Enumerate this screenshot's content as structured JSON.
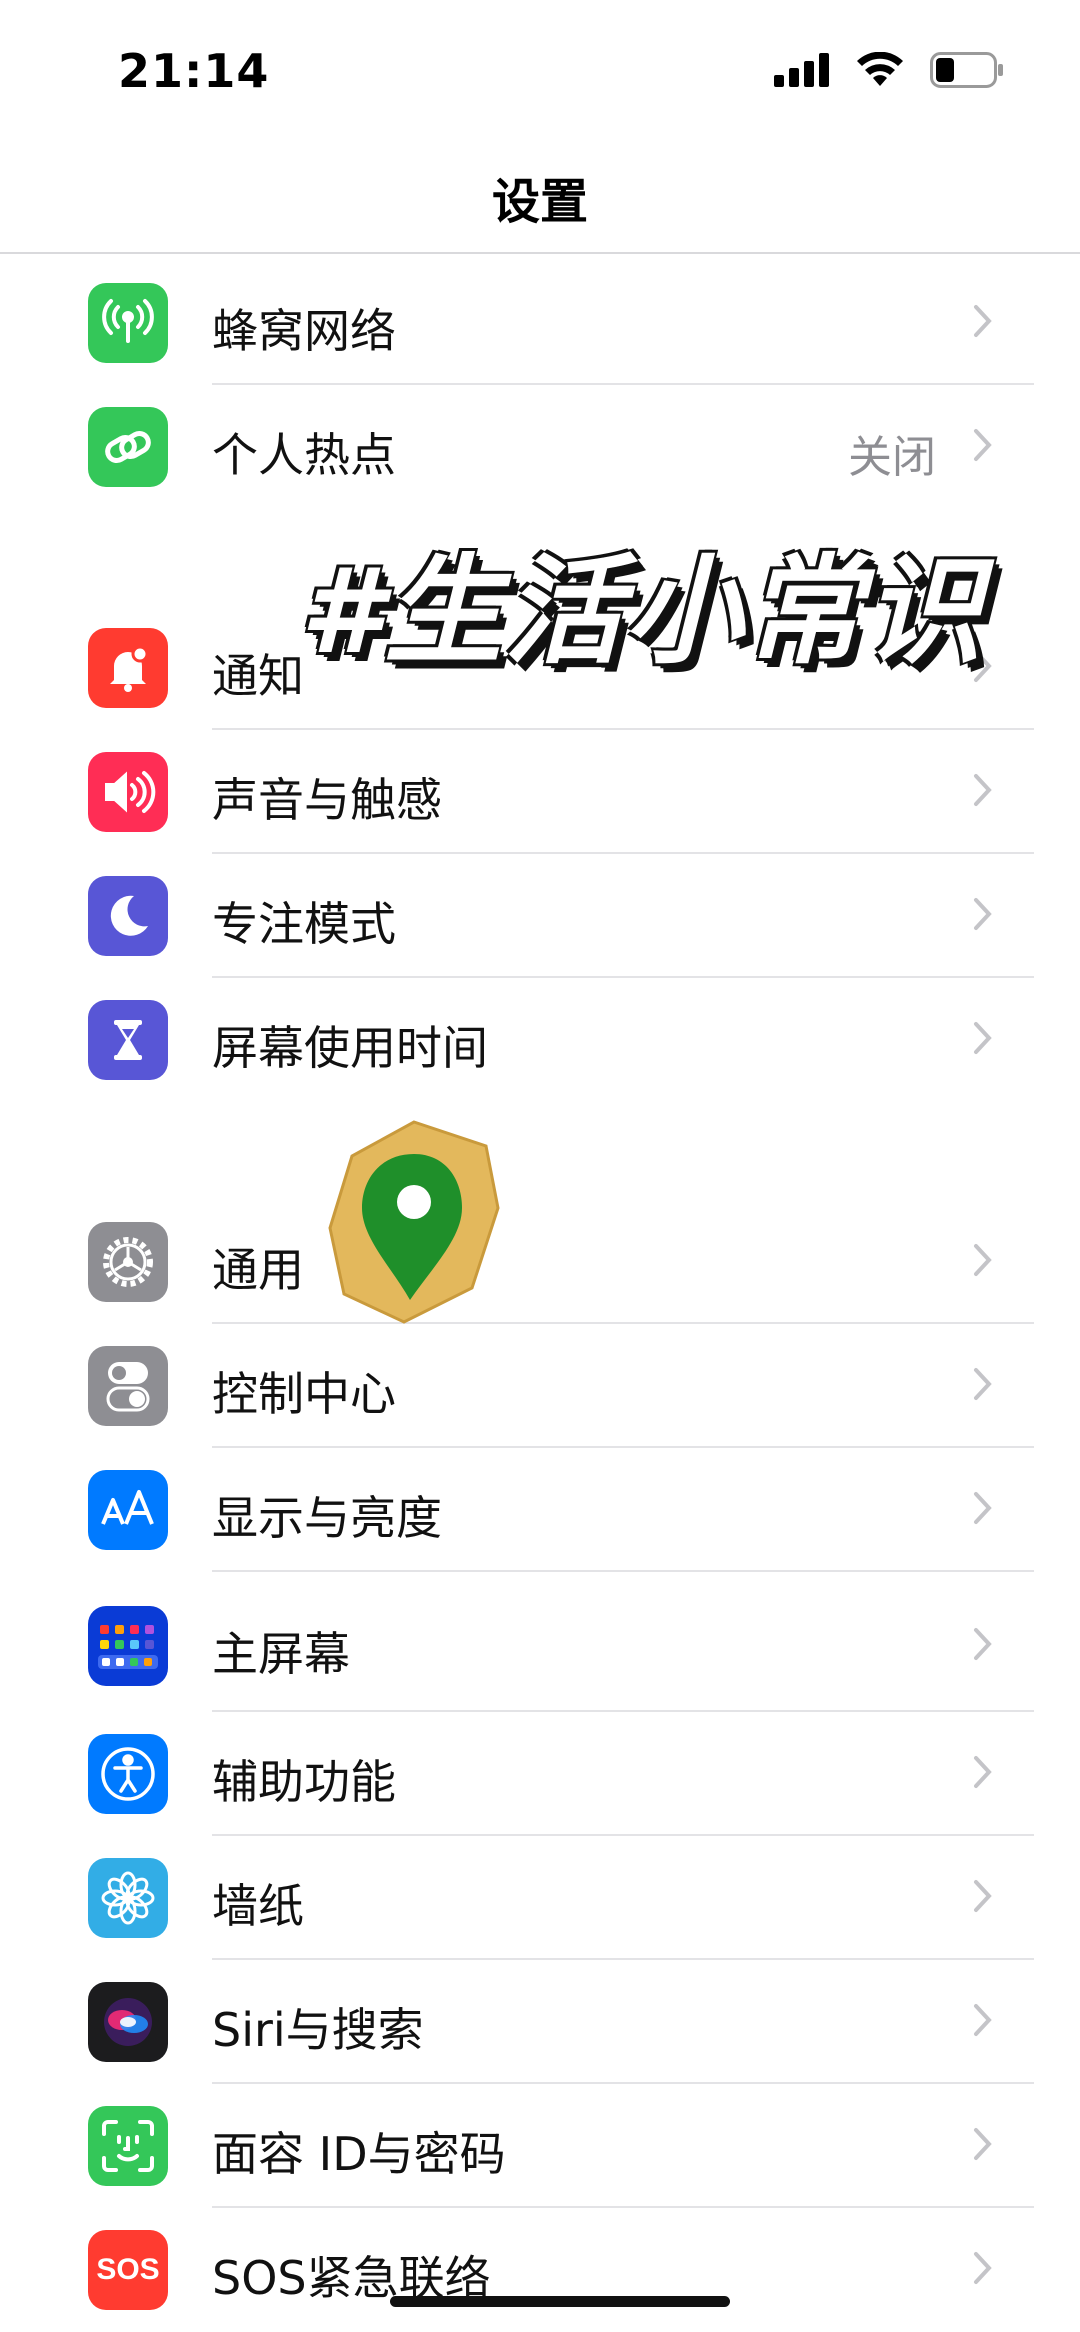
{
  "status_bar": {
    "time": "21:14"
  },
  "nav": {
    "title": "设置"
  },
  "groups": [
    {
      "items": [
        {
          "label": "蜂窝网络",
          "icon": "cellular-antenna-icon",
          "color": "#34c759"
        },
        {
          "label": "个人热点",
          "value": "关闭",
          "icon": "hotspot-chain-icon",
          "color": "#34c759"
        }
      ]
    },
    {
      "items": [
        {
          "label": "通知",
          "icon": "bell-icon",
          "color": "#ff3b30"
        },
        {
          "label": "声音与触感",
          "icon": "speaker-icon",
          "color": "#ff2d55"
        },
        {
          "label": "专注模式",
          "icon": "moon-icon",
          "color": "#5856d6"
        },
        {
          "label": "屏幕使用时间",
          "icon": "hourglass-icon",
          "color": "#5856d6"
        }
      ]
    },
    {
      "items": [
        {
          "label": "通用",
          "icon": "gear-icon",
          "color": "#8e8e93"
        },
        {
          "label": "控制中心",
          "icon": "toggle-switches-icon",
          "color": "#8e8e93"
        },
        {
          "label": "显示与亮度",
          "icon": "text-size-icon",
          "color": "#007aff"
        },
        {
          "label": "主屏幕",
          "icon": "app-grid-icon",
          "color": "#0a3bd6"
        },
        {
          "label": "辅助功能",
          "icon": "accessibility-icon",
          "color": "#007aff"
        },
        {
          "label": "墙纸",
          "icon": "flower-icon",
          "color": "#32ade6"
        },
        {
          "label": "Siri与搜索",
          "icon": "siri-orb-icon",
          "color": "#1c1c1e"
        },
        {
          "label": "面容 ID与密码",
          "icon": "face-id-icon",
          "color": "#34c759"
        },
        {
          "label": "SOS紧急联络",
          "icon": "sos-text-icon",
          "color": "#ff3b30",
          "icon_text": "SOS"
        }
      ]
    }
  ],
  "overlay": {
    "text": "#生活小常识"
  }
}
